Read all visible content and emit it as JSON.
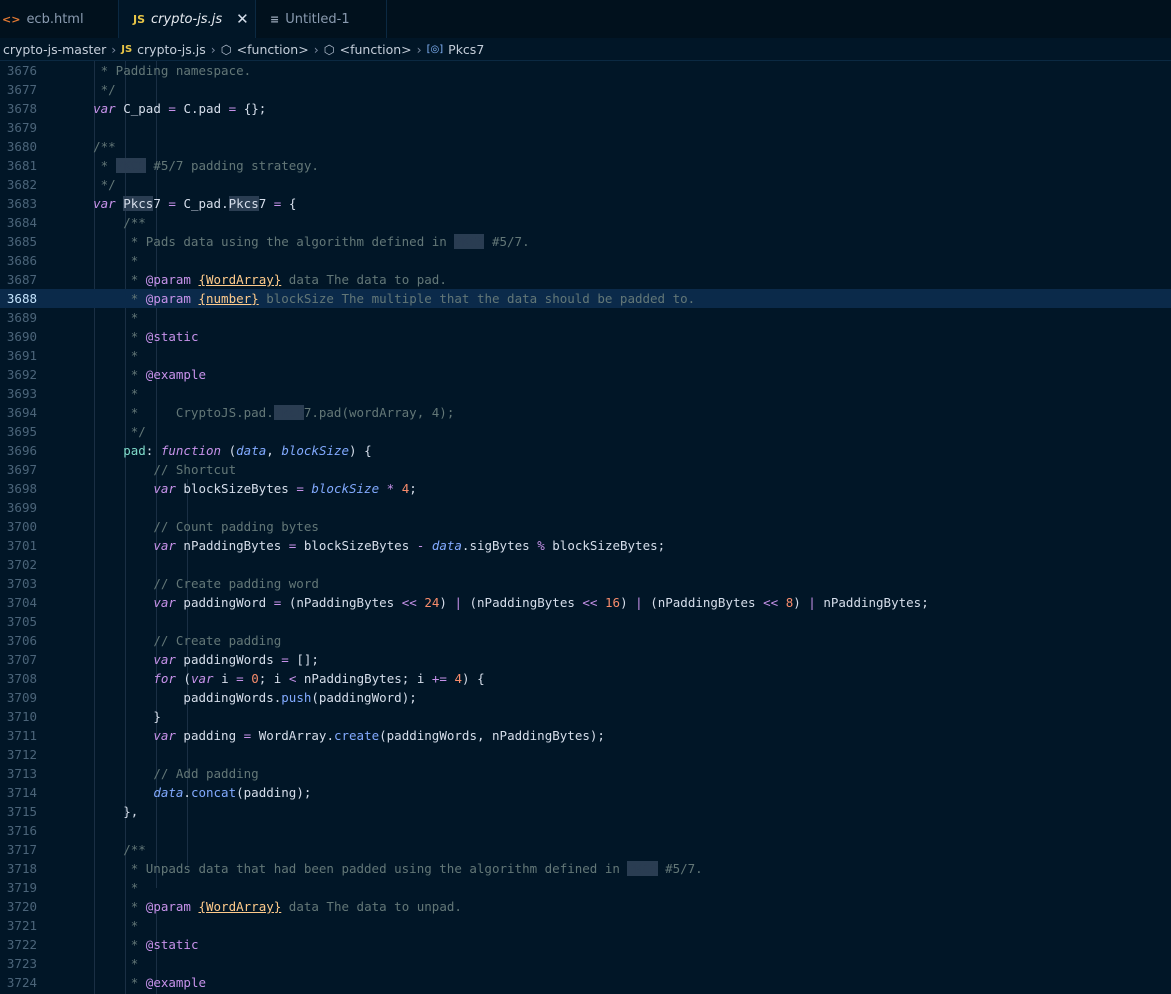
{
  "tabs": [
    {
      "label": "ecb.html",
      "icon": "html-icon"
    },
    {
      "label": "crypto-js.js",
      "icon": "js-icon"
    },
    {
      "label": "Untitled-1",
      "icon": "text-file-icon"
    }
  ],
  "breadcrumb": [
    "crypto-js-master",
    "crypto-js.js",
    "<function>",
    "<function>",
    "Pkcs7"
  ],
  "colors": {
    "background": "#011627",
    "comment": "#637777",
    "keyword": "#c792ea",
    "number": "#f78c6c",
    "function": "#82aaff",
    "property": "#7fdbca"
  },
  "current_line": "3688",
  "lines": [
    {
      "n": "3676",
      "t": "     * Padding namespace."
    },
    {
      "n": "3677",
      "t": "     */"
    },
    {
      "n": "3678",
      "t": "    var C_pad = C.pad = {};"
    },
    {
      "n": "3679",
      "t": ""
    },
    {
      "n": "3680",
      "t": "    /**"
    },
    {
      "n": "3681",
      "t": "     * PKCS #5/7 padding strategy."
    },
    {
      "n": "3682",
      "t": "     */"
    },
    {
      "n": "3683",
      "t": "    var Pkcs7 = C_pad.Pkcs7 = {"
    },
    {
      "n": "3684",
      "t": "        /**"
    },
    {
      "n": "3685",
      "t": "         * Pads data using the algorithm defined in PKCS #5/7."
    },
    {
      "n": "3686",
      "t": "         *"
    },
    {
      "n": "3687",
      "t": "         * @param {WordArray} data The data to pad."
    },
    {
      "n": "3688",
      "t": "         * @param {number} blockSize The multiple that the data should be padded to."
    },
    {
      "n": "3689",
      "t": "         *"
    },
    {
      "n": "3690",
      "t": "         * @static"
    },
    {
      "n": "3691",
      "t": "         *"
    },
    {
      "n": "3692",
      "t": "         * @example"
    },
    {
      "n": "3693",
      "t": "         *"
    },
    {
      "n": "3694",
      "t": "         *     CryptoJS.pad.Pkcs7.pad(wordArray, 4);"
    },
    {
      "n": "3695",
      "t": "         */"
    },
    {
      "n": "3696",
      "t": "        pad: function (data, blockSize) {"
    },
    {
      "n": "3697",
      "t": "            // Shortcut"
    },
    {
      "n": "3698",
      "t": "            var blockSizeBytes = blockSize * 4;"
    },
    {
      "n": "3699",
      "t": ""
    },
    {
      "n": "3700",
      "t": "            // Count padding bytes"
    },
    {
      "n": "3701",
      "t": "            var nPaddingBytes = blockSizeBytes - data.sigBytes % blockSizeBytes;"
    },
    {
      "n": "3702",
      "t": ""
    },
    {
      "n": "3703",
      "t": "            // Create padding word"
    },
    {
      "n": "3704",
      "t": "            var paddingWord = (nPaddingBytes << 24) | (nPaddingBytes << 16) | (nPaddingBytes << 8) | nPaddingBytes;"
    },
    {
      "n": "3705",
      "t": ""
    },
    {
      "n": "3706",
      "t": "            // Create padding"
    },
    {
      "n": "3707",
      "t": "            var paddingWords = [];"
    },
    {
      "n": "3708",
      "t": "            for (var i = 0; i < nPaddingBytes; i += 4) {"
    },
    {
      "n": "3709",
      "t": "                paddingWords.push(paddingWord);"
    },
    {
      "n": "3710",
      "t": "            }"
    },
    {
      "n": "3711",
      "t": "            var padding = WordArray.create(paddingWords, nPaddingBytes);"
    },
    {
      "n": "3712",
      "t": ""
    },
    {
      "n": "3713",
      "t": "            // Add padding"
    },
    {
      "n": "3714",
      "t": "            data.concat(padding);"
    },
    {
      "n": "3715",
      "t": "        },"
    },
    {
      "n": "3716",
      "t": ""
    },
    {
      "n": "3717",
      "t": "        /**"
    },
    {
      "n": "3718",
      "t": "         * Unpads data that had been padded using the algorithm defined in PKCS #5/7."
    },
    {
      "n": "3719",
      "t": "         *"
    },
    {
      "n": "3720",
      "t": "         * @param {WordArray} data The data to unpad."
    },
    {
      "n": "3721",
      "t": "         *"
    },
    {
      "n": "3722",
      "t": "         * @static"
    },
    {
      "n": "3723",
      "t": "         *"
    },
    {
      "n": "3724",
      "t": "         * @example"
    }
  ]
}
